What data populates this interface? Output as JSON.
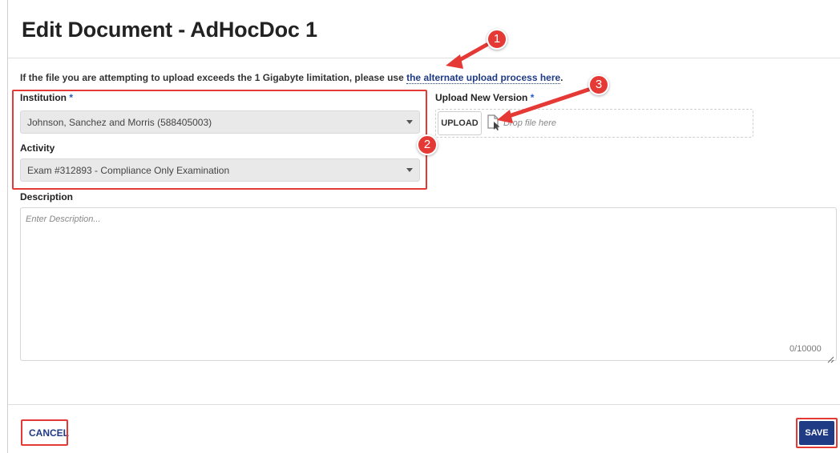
{
  "dialog": {
    "title": "Edit Document - AdHocDoc 1",
    "info_text": "If the file you are attempting to upload exceeds the 1 Gigabyte limitation, please use ",
    "info_link": "the alternate upload process here",
    "info_end": "."
  },
  "form": {
    "institution": {
      "label": "Institution",
      "required_mark": "*",
      "value": "Johnson, Sanchez and Morris (588405003)"
    },
    "activity": {
      "label": "Activity",
      "value": "Exam #312893 - Compliance Only Examination"
    },
    "upload": {
      "label": "Upload New Version",
      "required_mark": "*",
      "button_label": "UPLOAD",
      "drop_text": "Drop file here"
    },
    "description": {
      "label": "Description",
      "placeholder": "Enter Description...",
      "counter": "0/10000"
    }
  },
  "footer": {
    "cancel_label": "CANCEL",
    "save_label": "SAVE"
  },
  "annotations": {
    "badge_1": "1",
    "badge_2": "2",
    "badge_3": "3",
    "color": "#e53935"
  },
  "icons": [
    "file-drop-icon",
    "caret-down-icon",
    "resize-handle-icon"
  ]
}
